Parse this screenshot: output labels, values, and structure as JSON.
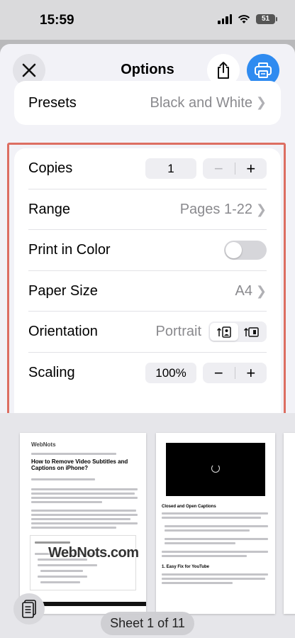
{
  "status_bar": {
    "time": "15:59",
    "battery": "51"
  },
  "nav": {
    "title": "Options"
  },
  "presets": {
    "label": "Presets",
    "value": "Black and White"
  },
  "options": {
    "copies": {
      "label": "Copies",
      "value": "1"
    },
    "range": {
      "label": "Range",
      "value": "Pages 1-22"
    },
    "print_in_color": {
      "label": "Print in Color",
      "enabled": false
    },
    "paper_size": {
      "label": "Paper Size",
      "value": "A4"
    },
    "orientation": {
      "label": "Orientation",
      "value": "Portrait",
      "options": [
        "portrait",
        "landscape"
      ],
      "selected": "portrait"
    },
    "scaling": {
      "label": "Scaling",
      "value": "100%"
    }
  },
  "stepper": {
    "minus": "−",
    "plus": "+"
  },
  "preview": {
    "page1_logo": "WebNots",
    "page1_title": "How to Remove Video Subtitles and Captions on iPhone?",
    "page2_heading": "Closed and Open Captions",
    "page2_subheading": "1. Easy Fix for YouTube",
    "watermark": "WebNots.com",
    "sheet_label": "Sheet 1 of 11"
  },
  "colors": {
    "accent": "#2f8bf0",
    "highlight_border": "#dd6e62"
  }
}
